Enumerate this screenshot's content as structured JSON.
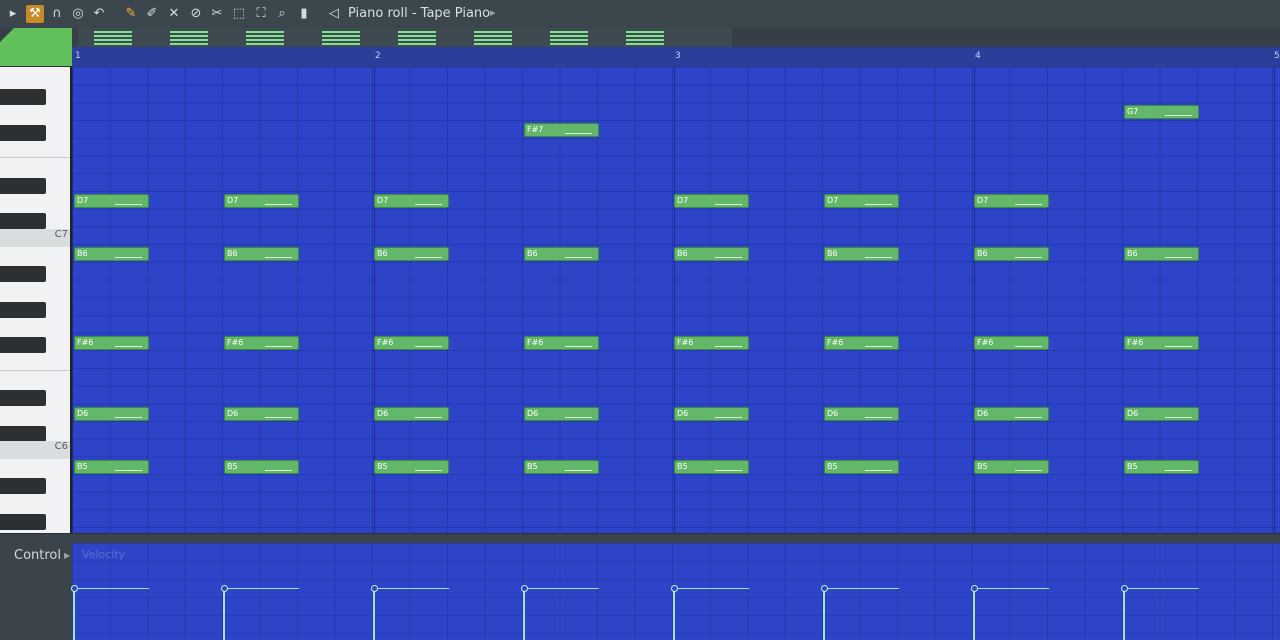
{
  "window": {
    "title": "Piano roll - Tape Piano"
  },
  "toolbar": {
    "icons": [
      "menu-arrow-icon",
      "wrench-icon",
      "magnet-icon",
      "stamp-icon",
      "undo-icon",
      "pencil-icon",
      "paint-brush-icon",
      "delete-icon",
      "mute-icon",
      "slice-icon",
      "select-icon",
      "zoom-icon",
      "playback-icon",
      "speaker-icon"
    ]
  },
  "ruler": {
    "bars": [
      "1",
      "2",
      "3",
      "4",
      "5"
    ]
  },
  "keyboard": {
    "labels": {
      "c7": "C7",
      "c6": "C6"
    }
  },
  "notes": [
    {
      "name": "D7",
      "bar": 1.0
    },
    {
      "name": "D7",
      "bar": 1.5
    },
    {
      "name": "D7",
      "bar": 2.0
    },
    {
      "name": "D7",
      "bar": 3.0
    },
    {
      "name": "D7",
      "bar": 3.5
    },
    {
      "name": "D7",
      "bar": 4.0
    },
    {
      "name": "F#7",
      "bar": 2.5
    },
    {
      "name": "G7",
      "bar": 4.5
    },
    {
      "name": "B6",
      "bar": 1.0
    },
    {
      "name": "B6",
      "bar": 1.5
    },
    {
      "name": "B6",
      "bar": 2.0
    },
    {
      "name": "B6",
      "bar": 2.5
    },
    {
      "name": "B6",
      "bar": 3.0
    },
    {
      "name": "B6",
      "bar": 3.5
    },
    {
      "name": "B6",
      "bar": 4.0
    },
    {
      "name": "B6",
      "bar": 4.5
    },
    {
      "name": "F#6",
      "bar": 1.0
    },
    {
      "name": "F#6",
      "bar": 1.5
    },
    {
      "name": "F#6",
      "bar": 2.0
    },
    {
      "name": "F#6",
      "bar": 2.5
    },
    {
      "name": "F#6",
      "bar": 3.0
    },
    {
      "name": "F#6",
      "bar": 3.5
    },
    {
      "name": "F#6",
      "bar": 4.0
    },
    {
      "name": "F#6",
      "bar": 4.5
    },
    {
      "name": "D6",
      "bar": 1.0
    },
    {
      "name": "D6",
      "bar": 1.5
    },
    {
      "name": "D6",
      "bar": 2.0
    },
    {
      "name": "D6",
      "bar": 2.5
    },
    {
      "name": "D6",
      "bar": 3.0
    },
    {
      "name": "D6",
      "bar": 3.5
    },
    {
      "name": "D6",
      "bar": 4.0
    },
    {
      "name": "D6",
      "bar": 4.5
    },
    {
      "name": "B5",
      "bar": 1.0
    },
    {
      "name": "B5",
      "bar": 1.5
    },
    {
      "name": "B5",
      "bar": 2.0
    },
    {
      "name": "B5",
      "bar": 2.5
    },
    {
      "name": "B5",
      "bar": 3.0
    },
    {
      "name": "B5",
      "bar": 3.5
    },
    {
      "name": "B5",
      "bar": 4.0
    },
    {
      "name": "B5",
      "bar": 4.5
    }
  ],
  "note_length_beats": 1,
  "control": {
    "label": "Control",
    "parameter": "Velocity"
  },
  "velocity_events": [
    1.0,
    1.5,
    2.0,
    2.5,
    3.0,
    3.5,
    4.0,
    4.5
  ],
  "colors": {
    "note": "#62b868",
    "grid": "#2e44c8",
    "ruler": "#2a3f9a",
    "velocity": "#9fe6c0"
  }
}
